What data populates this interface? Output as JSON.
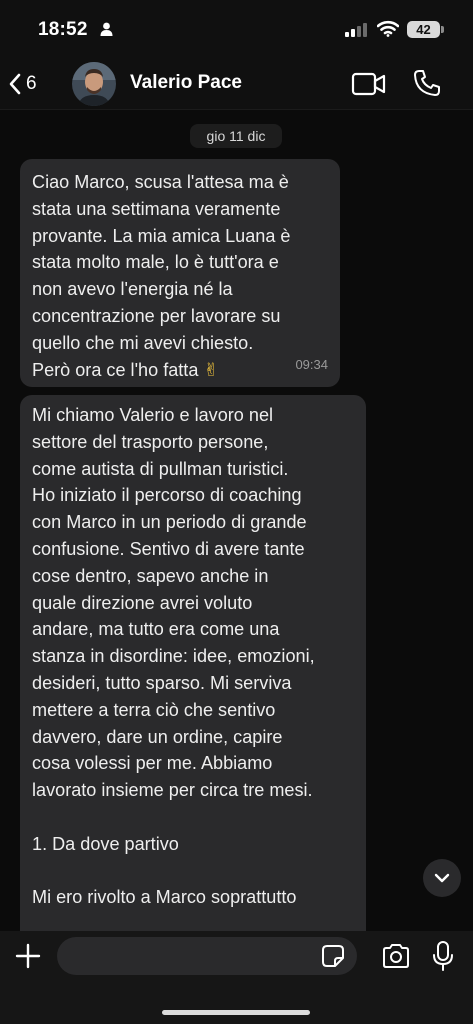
{
  "status_bar": {
    "time": "18:52",
    "battery": "42"
  },
  "header": {
    "back_count": "6",
    "contact_name": "Valerio Pace"
  },
  "chat": {
    "date_label": "gio 11 dic",
    "messages": [
      {
        "lines": [
          "Ciao Marco, scusa l'attesa ma è",
          "stata una settimana veramente",
          "provante. La mia amica Luana è",
          "stata molto male, lo è tutt'ora e",
          "non avevo l'energia né la",
          "concentrazione per lavorare su",
          "quello che mi avevi chiesto.",
          "Però ora ce l'ho fatta"
        ],
        "emoji": "✌",
        "time": "09:34"
      },
      {
        "lines": [
          "Mi chiamo Valerio e lavoro nel",
          "settore del trasporto persone,",
          "come autista di pullman turistici.",
          "Ho iniziato il percorso di coaching",
          "con Marco in un periodo di grande",
          "confusione. Sentivo di avere tante",
          "cose dentro, sapevo anche in",
          "quale direzione avrei voluto",
          "andare, ma tutto era come una",
          "stanza in disordine: idee, emozioni,",
          "desideri, tutto sparso. Mi serviva",
          "mettere a terra ciò che sentivo",
          "davvero, dare un ordine, capire",
          "cosa volessi per me. Abbiamo",
          "lavorato insieme per circa tre mesi."
        ],
        "section_title": "1. Da dove partivo",
        "extra_line": "Mi ero rivolto a Marco soprattutto"
      }
    ]
  },
  "composer": {
    "placeholder": ""
  },
  "colors": {
    "background": "#0b0b0b",
    "bubble": "#2a2a2c",
    "bar": "#101010"
  }
}
